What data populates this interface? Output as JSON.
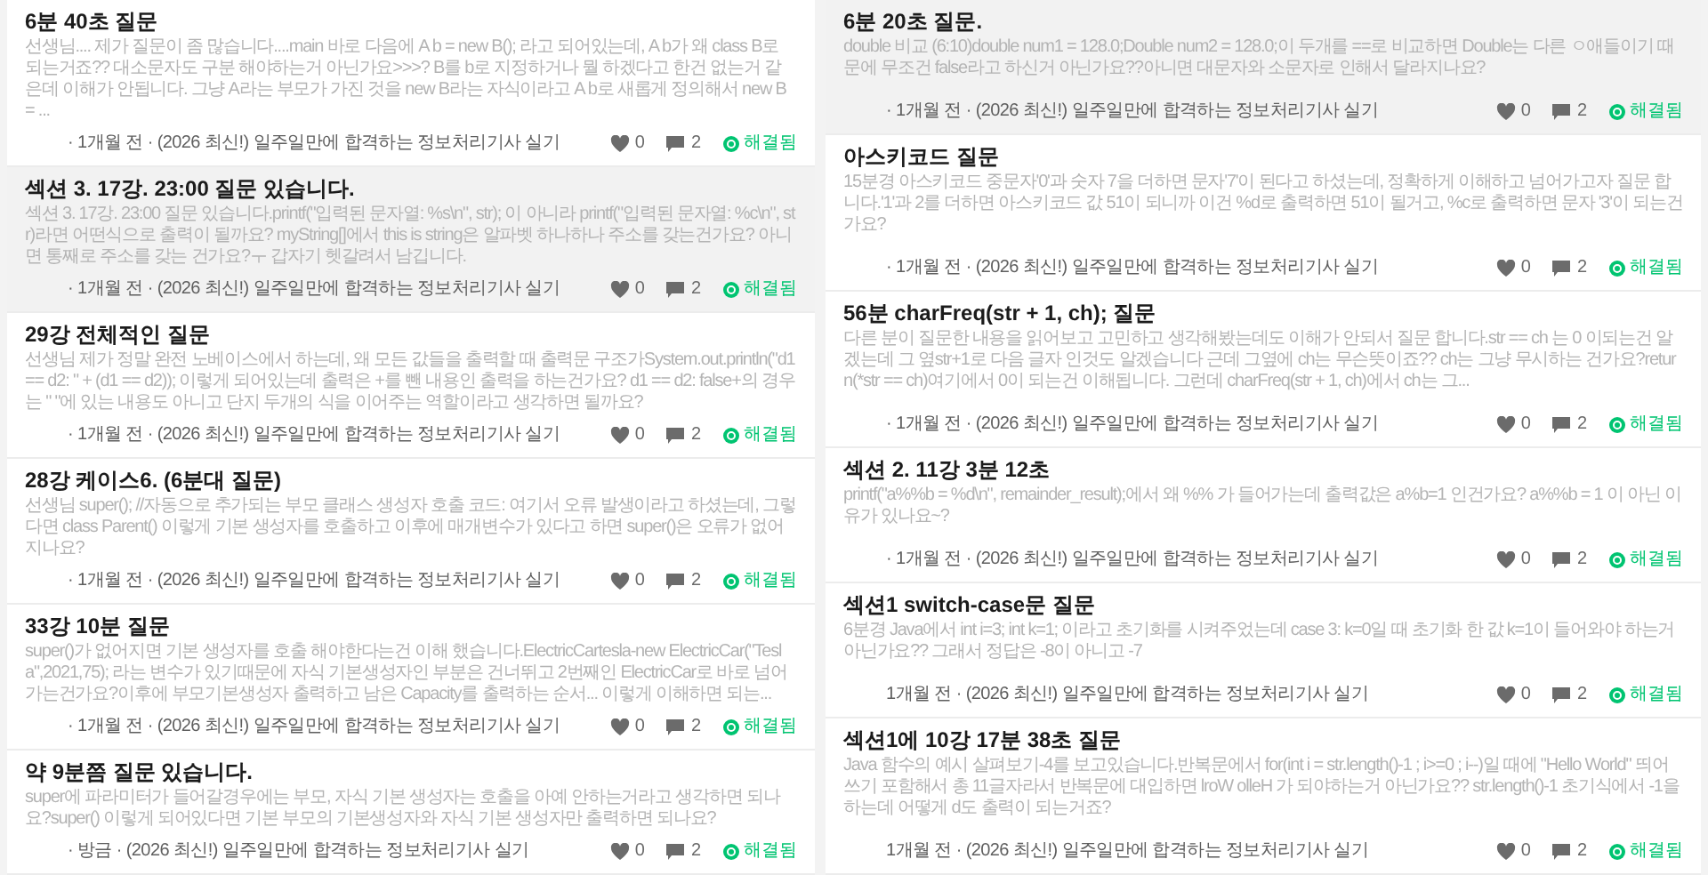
{
  "columns": [
    {
      "posts": [
        {
          "title": "6분 40초 질문",
          "body": "선생님.... 제가 질문이 좀 많습니다....main 바로 다음에 A b = new B(); 라고 되어있는데, A b가 왜 class B로 되는거죠?? 대소문자도 구분 해야하는거 아닌가요>>>? B를 b로 지정하거나 뭘 하겠다고 한건 없는거 같은데 이해가 안됩니다. 그냥 A라는 부모가 가진 것을 new B라는 자식이라고 A b로 새롭게 정의해서 new B = ...",
          "meta": "· 1개월 전 · (2026 최신!) 일주일만에 합격하는 정보처리기사 실기",
          "likes": "0",
          "comments": "2",
          "status": "해결됨",
          "hovered": false
        },
        {
          "title": "섹션 3. 17강. 23:00 질문 있습니다.",
          "body": "섹션 3. 17강. 23:00 질문 있습니다.printf(\"입력된 문자열: %s\\n\", str); 이 아니라 printf(\"입력된 문자열: %c\\n\", str)라면 어떤식으로 출력이 될까요? myString[]에서 this is string은 알파벳 하나하나 주소를 갖는건가요? 아니면 통째로 주소를 갖는 건가요?ㅜ 갑자기 헷갈려서 남깁니다.",
          "meta": "· 1개월 전 · (2026 최신!) 일주일만에 합격하는 정보처리기사 실기",
          "likes": "0",
          "comments": "2",
          "status": "해결됨",
          "hovered": true
        },
        {
          "title": "29강 전체적인 질문",
          "body": "선생님 제가 정말 완전 노베이스에서 하는데, 왜 모든 값들을 출력할 때 출력문 구조가System.out.println(\"d1 == d2: \" + (d1 == d2)); 이렇게 되어있는데 출력은 +를 뺀 내용인 출력을 하는건가요? d1 == d2: false+의 경우는 \" \"에 있는 내용도 아니고 단지 두개의 식을 이어주는 역할이라고 생각하면 될까요?",
          "meta": "· 1개월 전 · (2026 최신!) 일주일만에 합격하는 정보처리기사 실기",
          "likes": "0",
          "comments": "2",
          "status": "해결됨",
          "hovered": false
        },
        {
          "title": "28강 케이스6. (6분대 질문)",
          "body": "선생님 super(); //자동으로 추가되는 부모 클래스 생성자 호출 코드: 여기서 오류 발생이라고 하셨는데, 그렇다면 class Parent() 이렇게 기본 생성자를 호출하고 이후에 매개변수가 있다고 하면 super()은 오류가 없어지나요?",
          "meta": "· 1개월 전 · (2026 최신!) 일주일만에 합격하는 정보처리기사 실기",
          "likes": "0",
          "comments": "2",
          "status": "해결됨",
          "hovered": false
        },
        {
          "title": "33강 10분 질문",
          "body": "super()가 없어지면 기본 생성자를 호출 해야한다는건 이해 했습니다.ElectricCartesla-new ElectricCar(\"Tesla\",2021,75); 라는 변수가 있기때문에 자식 기본생성자인 부분은 건너뛰고 2번째인 ElectricCar로 바로 넘어가는건가요?이후에 부모기본생성자 출력하고 남은 Capacity를 출력하는 순서... 이렇게 이해하면 되는...",
          "meta": "· 1개월 전 · (2026 최신!) 일주일만에 합격하는 정보처리기사 실기",
          "likes": "0",
          "comments": "2",
          "status": "해결됨",
          "hovered": false
        },
        {
          "title": "약 9분쯤 질문 있습니다.",
          "body": "super에 파라미터가 들어갈경우에는 부모, 자식 기본 생성자는 호출을 아예 안하는거라고 생각하면 되나요?super() 이렇게 되어있다면 기본 부모의 기본생성자와 자식 기본 생성자만 출력하면 되나요?",
          "meta": "· 방금 · (2026 최신!) 일주일만에 합격하는 정보처리기사 실기",
          "likes": "0",
          "comments": "2",
          "status": "해결됨",
          "hovered": false
        }
      ]
    },
    {
      "posts": [
        {
          "title": "6분 20초 질문.",
          "body": "double 비교 (6:10)double num1 = 128.0;Double num2 = 128.0;이 두개를 ==로 비교하면 Double는 다른 ㅇ애들이기 때문에 무조건 false라고 하신거 아닌가요??아니면 대문자와 소문자로 인해서 달라지나요?",
          "meta": "· 1개월 전 · (2026 최신!) 일주일만에 합격하는 정보처리기사 실기",
          "likes": "0",
          "comments": "2",
          "status": "해결됨",
          "hovered": true
        },
        {
          "title": "아스키코드 질문",
          "body": "15분경 아스키코드 중문자'0'과 숫자 7을 더하면 문자'7'이 된다고 하셨는데, 정확하게 이해하고 넘어가고자 질문 합니다.'1'과 2를 더하면 아스키코드 값 51이 되니까 이건 %d로 출력하면 51이 될거고, %c로 출력하면 문자 '3'이 되는건가요?",
          "meta": "· 1개월 전 · (2026 최신!) 일주일만에 합격하는 정보처리기사 실기",
          "likes": "0",
          "comments": "2",
          "status": "해결됨",
          "hovered": false
        },
        {
          "title": "56분 charFreq(str + 1, ch); 질문",
          "body": "다른 분이 질문한 내용을 읽어보고 고민하고 생각해봤는데도 이해가 안되서 질문 합니다.str == ch 는 0 이되는건 알겠는데 그 옆str+1로 다음 글자 인것도 알겠습니다 근데 그옆에 ch는 무슨뜻이죠?? ch는 그냥 무시하는 건가요?return(*str == ch)여기에서 0이 되는건 이해됩니다. 그런데 charFreq(str + 1, ch)에서 ch는 그...",
          "meta": "· 1개월 전 · (2026 최신!) 일주일만에 합격하는 정보처리기사 실기",
          "likes": "0",
          "comments": "2",
          "status": "해결됨",
          "hovered": false
        },
        {
          "title": "섹션 2. 11강 3분 12초",
          "body": "printf(\"a%%b = %d\\n\", remainder_result);에서 왜 %% 가 들어가는데 출력값은 a%b=1 인건가요? a%%b = 1 이 아닌 이유가 있나요~?",
          "meta": "· 1개월 전 · (2026 최신!) 일주일만에 합격하는 정보처리기사 실기",
          "likes": "0",
          "comments": "2",
          "status": "해결됨",
          "hovered": false
        },
        {
          "title": "섹션1 switch-case문 질문",
          "body": "6분경 Java에서 int i=3; int k=1; 이라고 초기화를 시켜주었는데 case 3: k=0일 때 초기화 한 값 k=1이 들어와야 하는거 아닌가요?? 그래서 정답은 -8이 아니고 -7",
          "meta": "1개월 전 · (2026 최신!) 일주일만에 합격하는 정보처리기사 실기",
          "likes": "0",
          "comments": "2",
          "status": "해결됨",
          "hovered": false
        },
        {
          "title": "섹션1에 10강 17분 38초 질문",
          "body": "Java 함수의 예시 살펴보기-4를 보고있습니다.반복문에서 for(int i = str.length()-1 ; i>=0 ; i--)일 때에 \"Hello World\" 띄어쓰기 포함해서 총 11글자라서 반복문에 대입하면 lroW olleH 가 되야하는거 아닌가요?? str.length()-1 초기식에서 -1을 하는데 어떻게 d도 출력이 되는거죠?",
          "meta": "1개월 전 · (2026 최신!) 일주일만에 합격하는 정보처리기사 실기",
          "likes": "0",
          "comments": "2",
          "status": "해결됨",
          "hovered": false
        }
      ]
    }
  ]
}
